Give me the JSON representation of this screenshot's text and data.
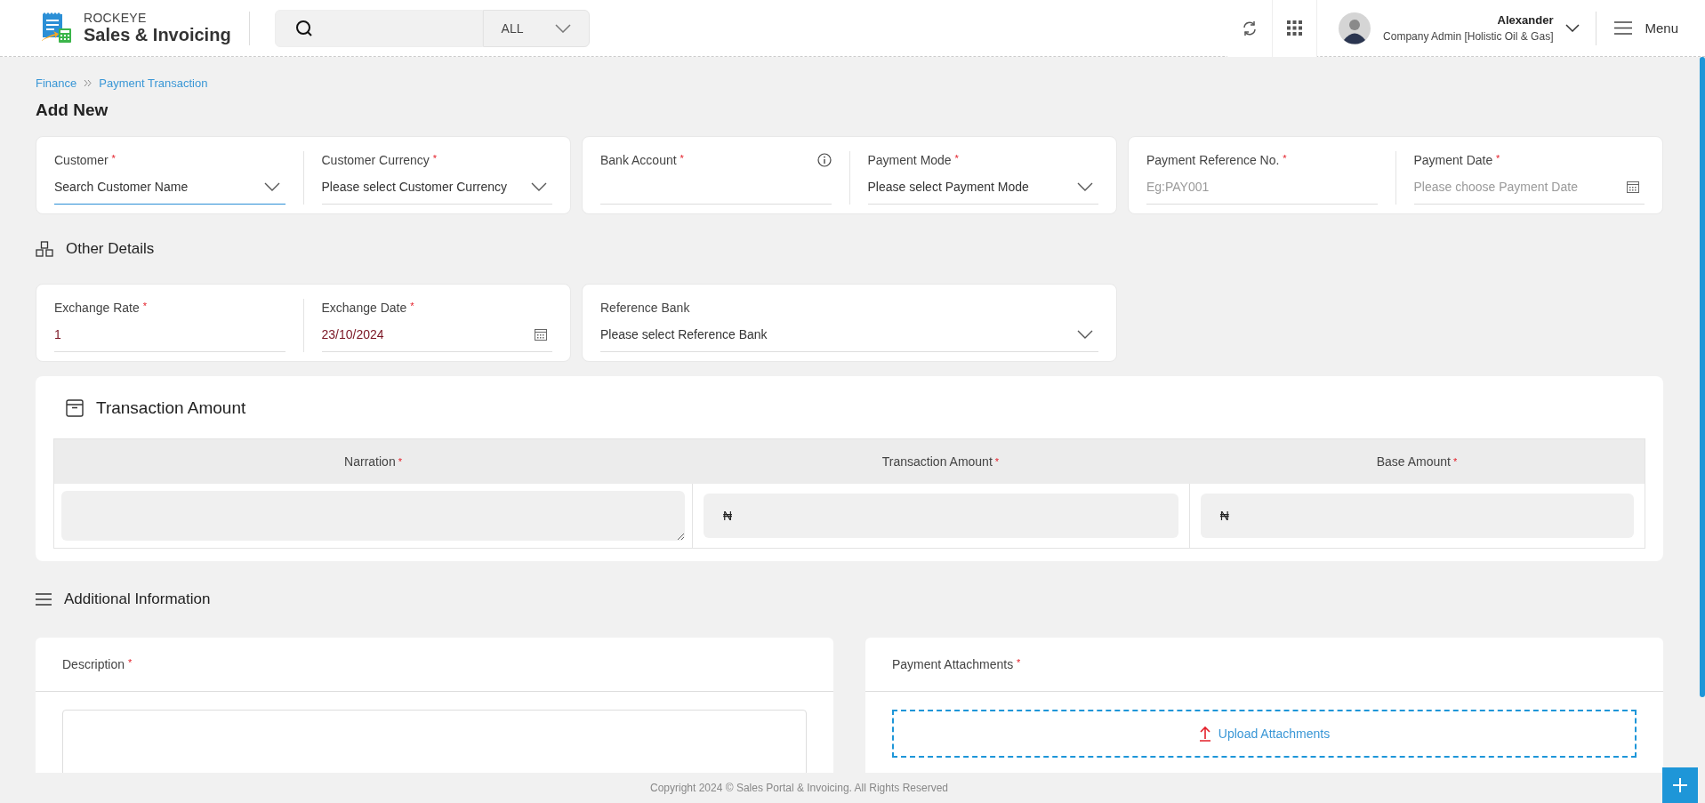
{
  "header": {
    "brand_top": "ROCKEYE",
    "brand": "Sales & Invoicing",
    "scope": "ALL",
    "user": {
      "name": "Alexander",
      "role": "Company Admin [Holistic Oil & Gas]"
    },
    "menu_label": "Menu"
  },
  "breadcrumb": [
    {
      "label": "Finance"
    },
    {
      "label": "Payment Transaction"
    }
  ],
  "page_title": "Add New",
  "main_cards": [
    {
      "fields": [
        {
          "label": "Customer",
          "asterisk": "*",
          "kind": "select",
          "placeholder": "Search Customer Name",
          "focused": true
        },
        {
          "label": "Customer Currency",
          "asterisk": "*",
          "kind": "select",
          "placeholder": "Please select Customer Currency",
          "focused": false
        }
      ]
    },
    {
      "fields": [
        {
          "label": "Bank Account",
          "asterisk": "*",
          "kind": "info",
          "focused": false
        },
        {
          "label": "Payment Mode",
          "asterisk": "*",
          "kind": "select",
          "placeholder": "Please select Payment Mode",
          "focused": false
        }
      ]
    },
    {
      "fields": [
        {
          "label": "Payment Reference No.",
          "asterisk": "*",
          "kind": "text",
          "placeholder": "Eg:PAY001",
          "focused": false
        },
        {
          "label": "Payment Date",
          "asterisk": "*",
          "kind": "date",
          "placeholder": "Please choose Payment Date",
          "focused": false
        }
      ]
    }
  ],
  "other_details": {
    "title": "Other Details",
    "cards": [
      {
        "fields": [
          {
            "label": "Exchange Rate",
            "asterisk": "*",
            "kind": "text",
            "value": "1",
            "focused": false
          },
          {
            "label": "Exchange Date",
            "asterisk": "*",
            "kind": "date",
            "value": "23/10/2024",
            "focused": false
          }
        ]
      },
      {
        "fields": [
          {
            "label": "Reference Bank",
            "kind": "select",
            "placeholder": "Please select Reference Bank",
            "focused": false
          }
        ]
      }
    ]
  },
  "transaction": {
    "title": "Transaction Amount",
    "columns": [
      {
        "label": "Narration",
        "asterisk": "*"
      },
      {
        "label": "Transaction Amount",
        "asterisk": "*"
      },
      {
        "label": "Base Amount",
        "asterisk": "*"
      }
    ],
    "cells": [
      {
        "kind": "textarea"
      },
      {
        "kind": "amount",
        "currency": "₦"
      },
      {
        "kind": "amount",
        "currency": "₦"
      }
    ]
  },
  "additional": {
    "title": "Additional Information",
    "description": {
      "label": "Description",
      "asterisk": "*"
    },
    "attachments": {
      "label": "Payment Attachments",
      "asterisk": "*",
      "upload": "Upload Attachments"
    }
  },
  "footer": "Copyright 2024 © Sales Portal & Invoicing. All Rights Reserved"
}
